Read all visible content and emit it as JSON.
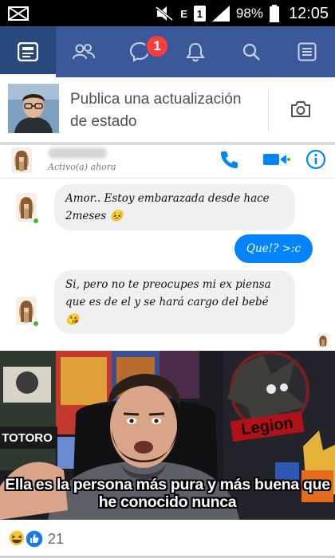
{
  "status_bar": {
    "icons": [
      "mail-icon",
      "mute-icon",
      "data-e-icon",
      "sim-1-icon",
      "signal-icon",
      "battery-icon"
    ],
    "network_label": "E",
    "sim_label": "1",
    "battery_percent": "98%",
    "time": "12:05"
  },
  "nav": {
    "accent_color": "#3b5998",
    "tabs": [
      "news-feed-icon",
      "friends-icon",
      "messenger-icon",
      "notifications-icon",
      "search-icon",
      "menu-icon"
    ],
    "messenger_badge": "1"
  },
  "composer": {
    "prompt": "Publica una actualización de estado",
    "camera_icon": "camera-icon"
  },
  "post_image": {
    "chat": {
      "status": "Activo(a) ahora",
      "actions": [
        "phone-icon",
        "video-icon",
        "info-icon"
      ],
      "messages": [
        {
          "from": "contact",
          "text": "Amor.. Estoy embarazada desde hace 2meses 😣"
        },
        {
          "from": "me",
          "text": "Que!? >:c"
        },
        {
          "from": "contact",
          "text": "Si, pero no te preocupes mi ex piensa que es de el y se hará cargo del bebé 😘"
        }
      ],
      "bubble_in_color": "#f1f0f0",
      "bubble_out_color": "#0084ff"
    },
    "meme": {
      "caption": "Ella es la persona más pura y más buena que he conocido nunca",
      "poster_text": "TOTORO",
      "sticker_text": "Legion"
    }
  },
  "reactions": {
    "icons": [
      "haha-reaction-icon",
      "like-reaction-icon"
    ],
    "count": "21"
  }
}
